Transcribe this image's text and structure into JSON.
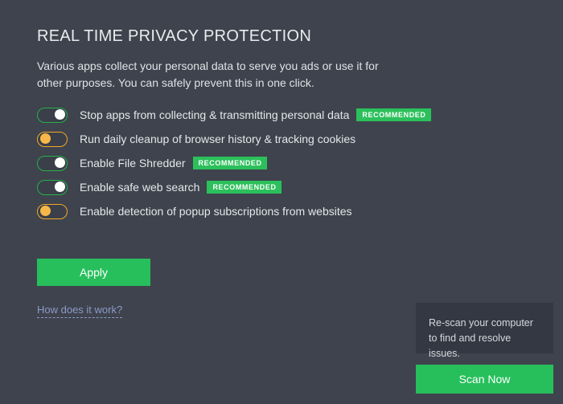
{
  "header": {
    "title": "REAL TIME PRIVACY PROTECTION",
    "description": "Various apps collect your personal data to serve you ads or use it for other purposes. You can safely prevent this in one click."
  },
  "options": [
    {
      "label": "Stop apps from collecting & transmitting personal data",
      "state": "on",
      "badge": "RECOMMENDED"
    },
    {
      "label": "Run daily cleanup of browser history & tracking cookies",
      "state": "off",
      "badge": null
    },
    {
      "label": "Enable File Shredder",
      "state": "on",
      "badge": "RECOMMENDED"
    },
    {
      "label": "Enable safe web search",
      "state": "on",
      "badge": "RECOMMENDED"
    },
    {
      "label": "Enable detection of popup subscriptions from websites",
      "state": "off",
      "badge": null
    }
  ],
  "actions": {
    "apply_label": "Apply",
    "how_link_label": "How does it work?",
    "scan_now_label": "Scan Now"
  },
  "tooltip": {
    "text": "Re-scan your computer to find and resolve issues."
  },
  "colors": {
    "background": "#3f434d",
    "accent_green": "#27bf5c",
    "toggle_on": "#22b24c",
    "toggle_off": "#f0a92a",
    "badge_green": "#2bc05b",
    "tooltip_background": "#343842",
    "link": "#8b9bc9"
  }
}
